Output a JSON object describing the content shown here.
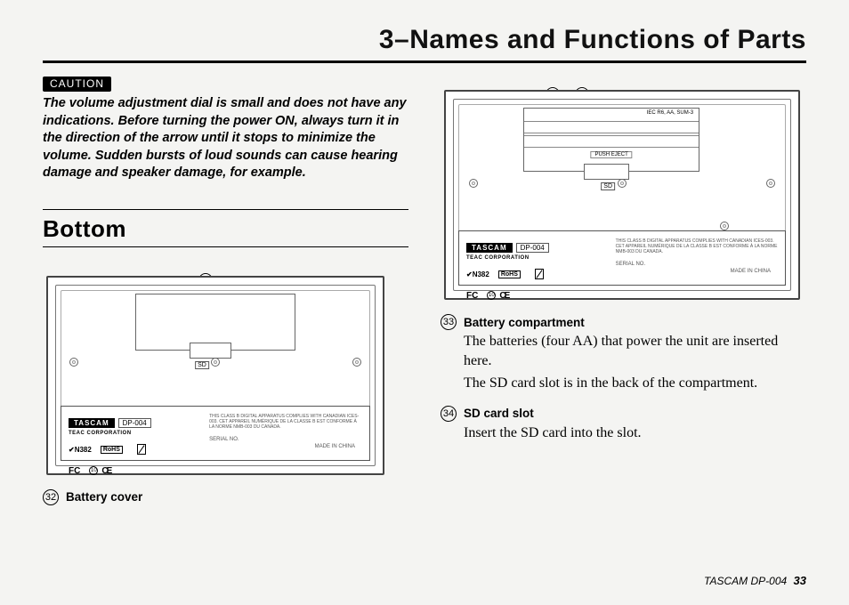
{
  "chapter_title": "3–Names and Functions of Parts",
  "caution": {
    "label": "CAUTION",
    "text": "The volume adjustment dial is small and does not have any indications. Before turning the power ON, always turn it in the direction of the arrow until it stops to minimize the volume. Sudden bursts of loud sounds can cause hearing damage and speaker damage, for example."
  },
  "section_heading": "Bottom",
  "parts": {
    "n32": {
      "num": "32",
      "name": "Battery cover"
    },
    "n33": {
      "num": "33",
      "name": "Battery compartment",
      "desc1": "The batteries (four AA) that power the unit are inserted here.",
      "desc2": "The SD card slot is in the back of the compartment."
    },
    "n34": {
      "num": "34",
      "name": "SD card slot",
      "desc1": "Insert the SD card into the slot."
    }
  },
  "device_label": {
    "brand": "TASCAM",
    "model": "DP-004",
    "corp": "TEAC CORPORATION",
    "batt_spec": "IEC R6, AA, SUM-3",
    "push_eject": "PUSH EJECT",
    "sd": "SD",
    "cert_code": "N382",
    "rohs": "RoHS",
    "fcc": "FC",
    "ce": "CE",
    "serial_label": "SERIAL NO.",
    "made_in": "MADE IN CHINA",
    "compliance": "THIS CLASS B DIGITAL APPARATUS COMPLIES WITH CANADIAN ICES-003. CET APPAREIL NUMÉRIQUE DE LA CLASSE B EST CONFORME À LA NORME NMB-003 DU CANADA."
  },
  "footer": {
    "product": "TASCAM  DP-004",
    "page": "33"
  }
}
